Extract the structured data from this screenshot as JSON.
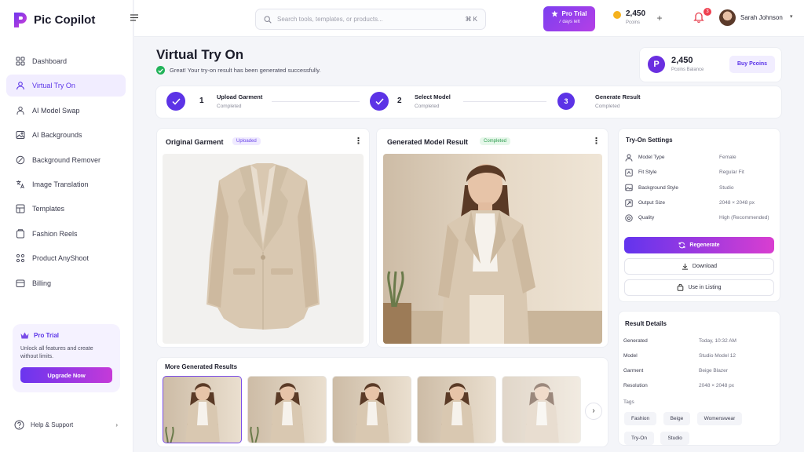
{
  "brand": {
    "name": "Pic Copilot"
  },
  "sidebar": {
    "items": [
      {
        "label": "Dashboard",
        "icon": "grid-icon",
        "active": false
      },
      {
        "label": "Virtual Try On",
        "icon": "user-icon",
        "active": true
      },
      {
        "label": "AI Model Swap",
        "icon": "person-icon",
        "active": false
      },
      {
        "label": "AI Backgrounds",
        "icon": "image-icon",
        "active": false
      },
      {
        "label": "Background Remover",
        "icon": "eraser-icon",
        "active": false
      },
      {
        "label": "Image Translation",
        "icon": "translate-icon",
        "active": false
      },
      {
        "label": "Templates",
        "icon": "layout-icon",
        "active": false
      },
      {
        "label": "Fashion Reels",
        "icon": "film-icon",
        "active": false
      },
      {
        "label": "Product AnyShoot",
        "icon": "aperture-icon",
        "active": false
      },
      {
        "label": "Billing",
        "icon": "card-icon",
        "active": false
      }
    ],
    "promo": {
      "title": "Pro Trial",
      "text": "Unlock all features and create without limits.",
      "button": "Upgrade Now"
    },
    "help": "Help & Support"
  },
  "topbar": {
    "search_placeholder": "Search tools, templates, or products...",
    "shortcut": "⌘ K",
    "pro_trial": "Pro Trial",
    "trial_left": "7 days left",
    "coins": "2,450",
    "coins_label": "Pcoins",
    "notifications": "3",
    "user": "Sarah Johnson"
  },
  "page": {
    "title": "Virtual Try On",
    "success": "Great! Your try-on result has been generated successfully."
  },
  "balance": {
    "icon_letter": "P",
    "value": "2,450",
    "label": "Pcoins Balance",
    "buy": "Buy Pcoins"
  },
  "steps": [
    {
      "num": "1",
      "title": "Upload Garment",
      "status": "Completed"
    },
    {
      "num": "2",
      "title": "Select Model",
      "status": "Completed"
    },
    {
      "num": "3",
      "title": "Generate Result",
      "status": "Completed"
    }
  ],
  "garment": {
    "title": "Original Garment",
    "badge": "Uploaded"
  },
  "result": {
    "title": "Generated Model Result",
    "badge": "Completed"
  },
  "settings": {
    "title": "Try-On Settings",
    "rows": [
      {
        "label": "Model Type",
        "value": "Female",
        "icon": "person-icon"
      },
      {
        "label": "Fit Style",
        "value": "Regular Fit",
        "icon": "fit-icon"
      },
      {
        "label": "Background Style",
        "value": "Studio",
        "icon": "image-icon"
      },
      {
        "label": "Output Size",
        "value": "2048 × 2048 px",
        "icon": "resize-icon"
      },
      {
        "label": "Quality",
        "value": "High (Recommended)",
        "icon": "quality-icon"
      }
    ],
    "regenerate": "Regenerate",
    "download": "Download",
    "use": "Use in Listing"
  },
  "details": {
    "title": "Result Details",
    "rows": [
      {
        "label": "Generated",
        "value": "Today, 10:32 AM"
      },
      {
        "label": "Model",
        "value": "Studio Model 12"
      },
      {
        "label": "Garment",
        "value": "Beige Blazer"
      },
      {
        "label": "Resolution",
        "value": "2048 × 2048 px"
      }
    ],
    "tags_label": "Tags",
    "tags": [
      "Fashion",
      "Beige",
      "Womenswear",
      "Try-On",
      "Studio"
    ]
  },
  "more": {
    "title": "More Generated Results",
    "count": 5
  },
  "colors": {
    "accent": "#5c33e6",
    "gradient_end": "#d93ed0",
    "success": "#22b35a",
    "blazer": "#d9c8b1"
  }
}
